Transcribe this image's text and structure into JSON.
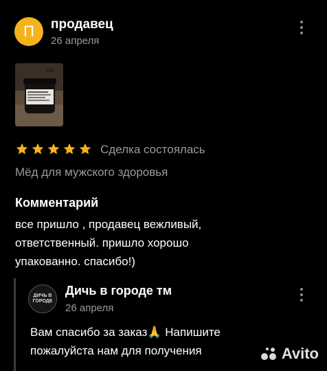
{
  "review": {
    "avatar_letter": "П",
    "author": "продавец",
    "date": "26 апреля",
    "rating": 5,
    "deal_status": "Сделка состоялась",
    "product": "Мёд для мужского здоровья",
    "comment_heading": "Комментарий",
    "comment_text": "все пришло , продавец вежливый,\nответственный. пришло хорошо\nупакованно. спасибо!)"
  },
  "reply": {
    "avatar_text": "ДИЧЬ В ГОРОДЕ",
    "author": "Дичь в городе тм",
    "date": "26 апреля",
    "text": "Вам спасибо за заказ🙏 Напишите\nпожалуйста нам для получения"
  },
  "watermark": "Avito",
  "colors": {
    "avatar_bg": "#f5b31c",
    "star": "#f5b31c",
    "muted_text": "#9a9a9a",
    "background": "#000000"
  }
}
